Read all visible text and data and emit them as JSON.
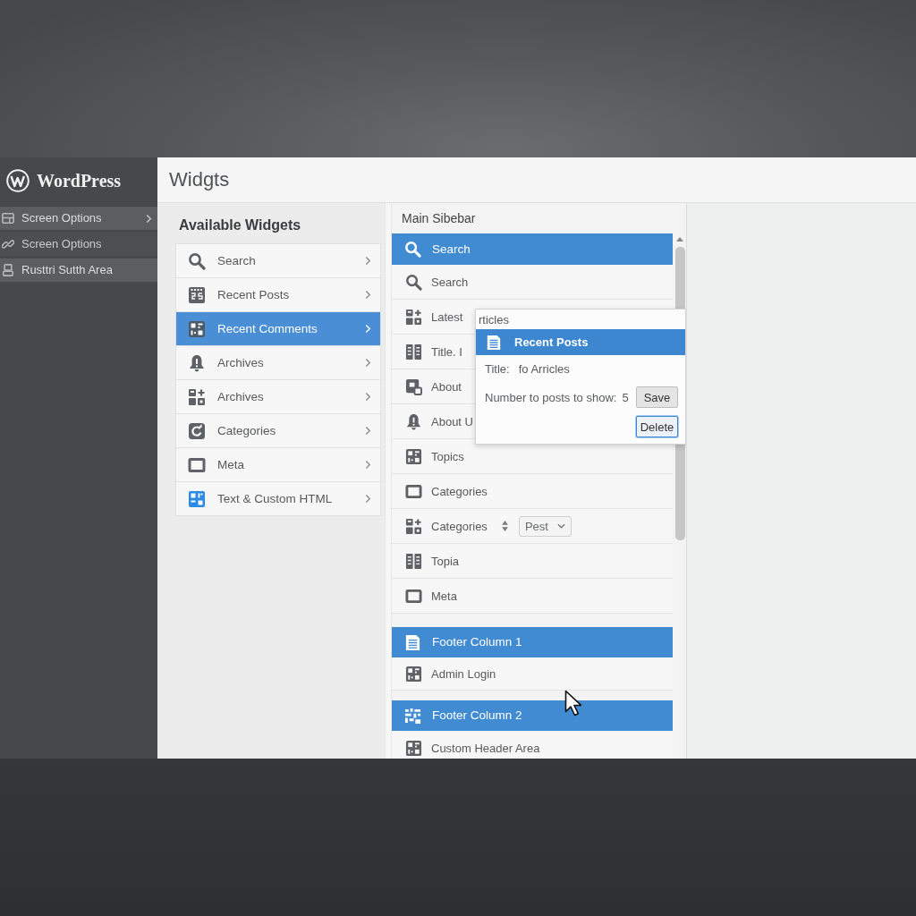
{
  "sidebar": {
    "logo": "WordPress",
    "items": [
      {
        "label": "Screen Options",
        "highlighted": true,
        "submenu": true
      },
      {
        "label": "Screen Options",
        "highlighted": false,
        "submenu": false
      },
      {
        "label": "Rusttri Sutth Area",
        "highlighted": true,
        "submenu": false
      }
    ]
  },
  "page_title": "Widgts",
  "available_widgets": {
    "title": "Available Widgets",
    "items": [
      {
        "label": "Search",
        "selected": false
      },
      {
        "label": "Recent Posts",
        "selected": false
      },
      {
        "label": "Recent Comments",
        "selected": true
      },
      {
        "label": "Archives",
        "selected": false
      },
      {
        "label": "Archives",
        "selected": false
      },
      {
        "label": "Categories",
        "selected": false
      },
      {
        "label": "Meta",
        "selected": false
      },
      {
        "label": "Text & Custom HTML",
        "selected": false
      }
    ]
  },
  "main_sidebar": {
    "title": "Main Sibebar",
    "areas": [
      {
        "title": "Search",
        "items": [
          {
            "kind": "widget",
            "label": "Search"
          },
          {
            "kind": "widget",
            "label": "Latest"
          },
          {
            "kind": "widget",
            "label": "Title. I"
          },
          {
            "kind": "widget",
            "label": "About"
          },
          {
            "kind": "widget",
            "label": "About U"
          },
          {
            "kind": "widget",
            "label": "Topics"
          },
          {
            "kind": "widget",
            "label": "Categories"
          },
          {
            "kind": "select",
            "label": "Categories",
            "value": "Pest"
          },
          {
            "kind": "widget",
            "label": "Topia"
          },
          {
            "kind": "widget",
            "label": "Meta"
          }
        ]
      },
      {
        "title": "Footer Column 1",
        "items": [
          {
            "kind": "widget",
            "label": "Admin Login"
          }
        ]
      },
      {
        "title": "Footer Column 2",
        "items": [
          {
            "kind": "widget",
            "label": "Custom Header Area"
          }
        ]
      }
    ]
  },
  "widget_popup": {
    "caption": "rticles",
    "title": "Recent Posts",
    "title_label": "Title:",
    "title_value": "fo Arricles",
    "count_label": "Number to posts to show:",
    "count_value": "5",
    "buttons": [
      {
        "label": "Save",
        "focused": false
      },
      {
        "label": "Delete",
        "focused": true
      }
    ]
  }
}
